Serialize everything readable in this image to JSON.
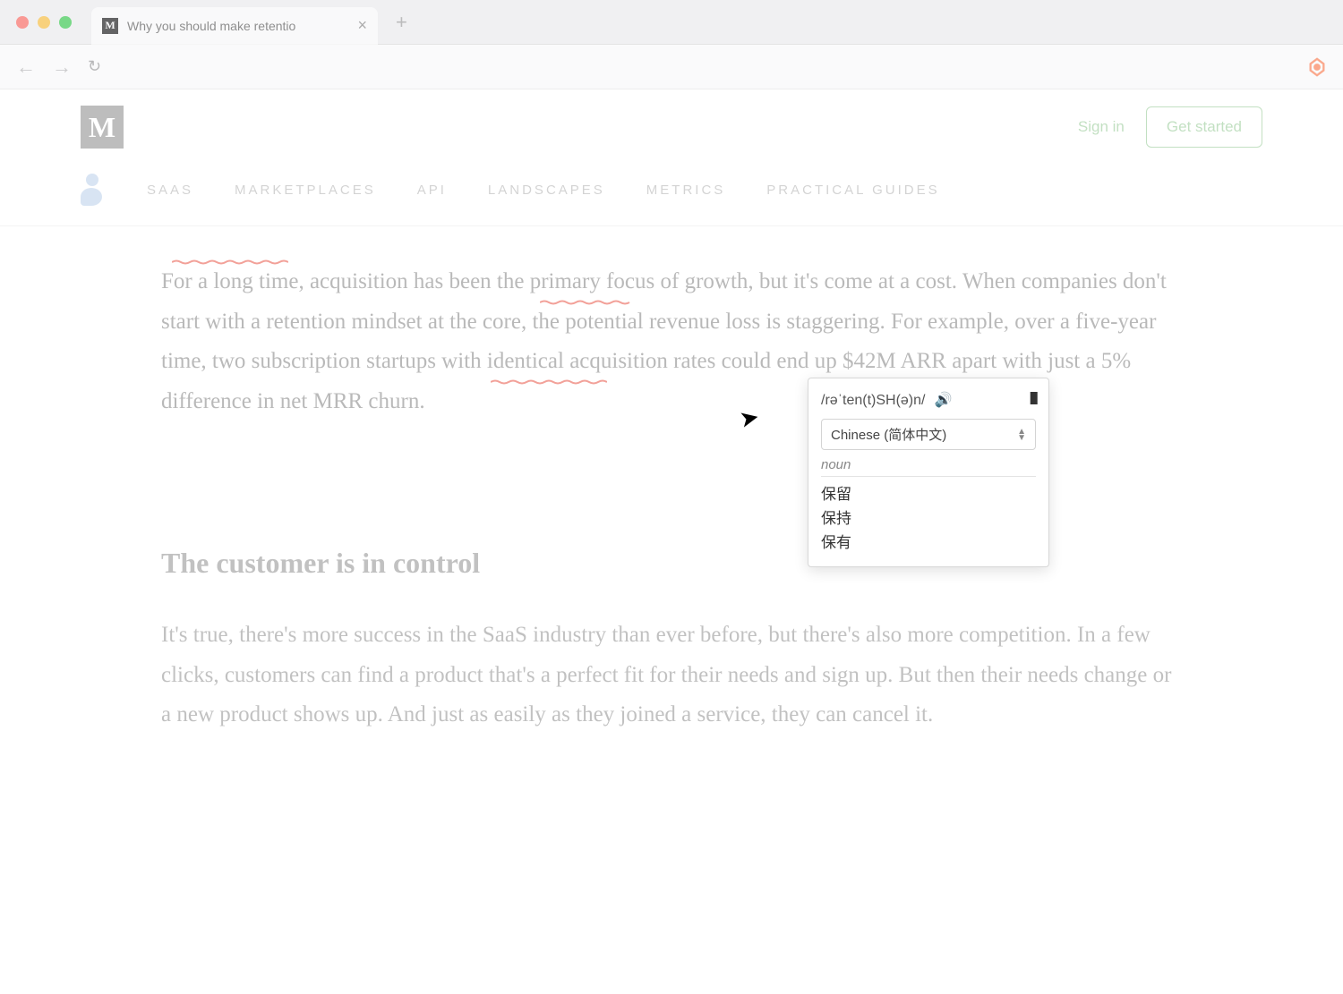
{
  "browser": {
    "tab_title": "Why you should make retentio",
    "favicon_letter": "M",
    "close_symbol": "×",
    "new_tab_symbol": "+"
  },
  "toolbar": {
    "back": "←",
    "forward": "→",
    "reload": "↻"
  },
  "header": {
    "logo_letter": "M",
    "sign_in": "Sign in",
    "get_started": "Get started"
  },
  "nav": {
    "items": [
      "SAAS",
      "MARKETPLACES",
      "API",
      "LANDSCAPES",
      "METRICS",
      "PRACTICAL GUIDES"
    ]
  },
  "article": {
    "paragraph1": "For a long time, acquisition has been the primary focus of growth, but it's come at a cost. When companies don't start with a retention mindset at the core, the potential revenue loss is staggering. For example, over a five-year time, two subscription startups with identical acquisition rates could end up $42M ARR apart with just a 5% difference in net MRR churn.",
    "heading": "The customer is in control",
    "paragraph2": "It's true, there's more success in the SaaS industry than ever before, but there's also more competition. In a few clicks, customers can find a product that's a perfect fit for their needs and sign up. But then their needs change or a new product shows up. And just as easily as they joined a service, they can cancel it."
  },
  "tooltip": {
    "phonetic": "/rəˈten(t)SH(ə)n/",
    "speaker": "🔊",
    "columns": "III",
    "language": "Chinese (简体中文)",
    "pos": "noun",
    "translations": [
      "保留",
      "保持",
      "保有"
    ]
  }
}
